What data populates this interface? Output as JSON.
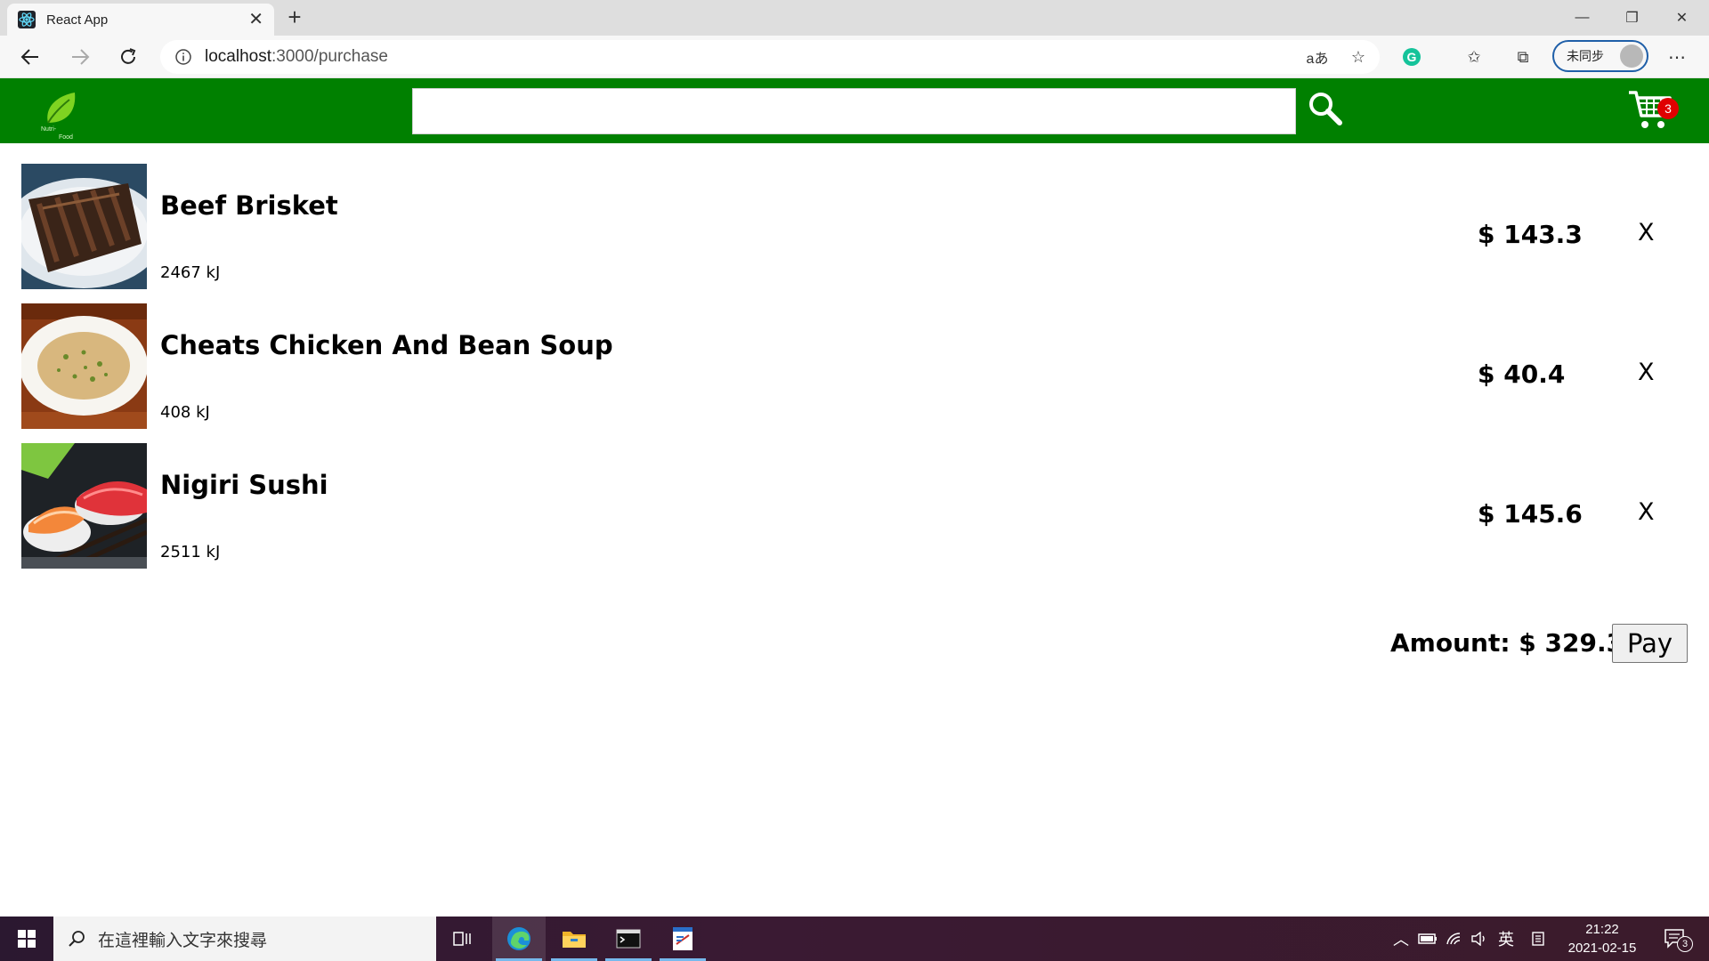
{
  "browser": {
    "tab_title": "React App",
    "url_host": "localhost",
    "url_path": ":3000/purchase",
    "profile_label": "未同步"
  },
  "header": {
    "logo_text_1": "Nutri-",
    "logo_text_2": "Food",
    "search_value": "",
    "cart_count": "3",
    "brand_color": "#008000",
    "badge_color": "#e00000"
  },
  "cart": {
    "items": [
      {
        "name": "Beef Brisket",
        "energy": "2467 kJ",
        "price": "$ 143.3",
        "remove_label": "X"
      },
      {
        "name": "Cheats Chicken And Bean Soup",
        "energy": "408 kJ",
        "price": "$ 40.4",
        "remove_label": "X"
      },
      {
        "name": "Nigiri Sushi",
        "energy": "2511 kJ",
        "price": "$ 145.6",
        "remove_label": "X"
      }
    ],
    "amount_text": "Amount: $ 329.3",
    "pay_label": "Pay"
  },
  "taskbar": {
    "search_placeholder": "在這裡輸入文字來搜尋",
    "ime_label": "英",
    "time": "21:22",
    "date": "2021-02-15",
    "notification_count": "3"
  }
}
